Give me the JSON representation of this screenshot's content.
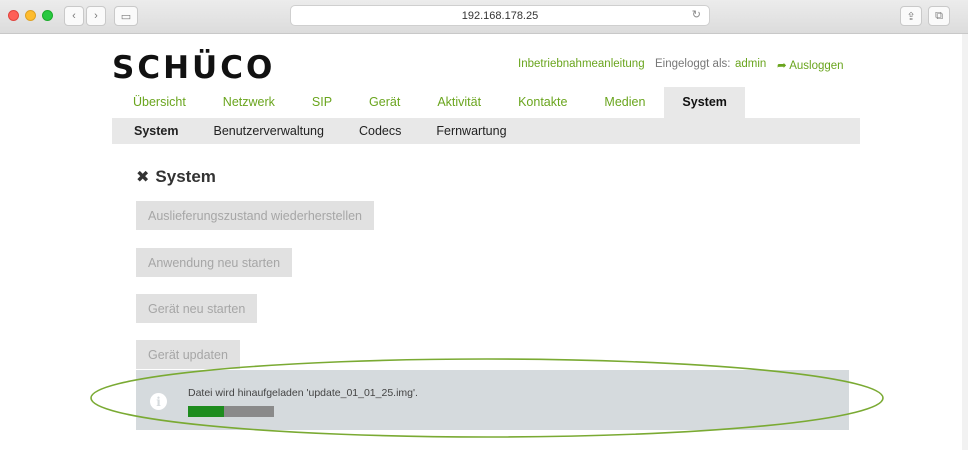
{
  "browser": {
    "address": "192.168.178.25",
    "back_glyph": "‹",
    "forward_glyph": "›",
    "reload_glyph": "↻",
    "share_glyph": "⇪",
    "tabs_glyph": "⧉",
    "sidebar_glyph": "▭"
  },
  "header": {
    "logo": "SCHÜCO",
    "links": {
      "manual": "Inbetriebnahmeanleitung",
      "logged_in_prefix": "Eingeloggt als:",
      "user": "admin",
      "logout": "Ausloggen",
      "logout_icon": "➦"
    }
  },
  "nav": {
    "items": [
      "Übersicht",
      "Netzwerk",
      "SIP",
      "Gerät",
      "Aktivität",
      "Kontakte",
      "Medien",
      "System"
    ],
    "active": "System"
  },
  "subnav": {
    "items": [
      "System",
      "Benutzerverwaltung",
      "Codecs",
      "Fernwartung"
    ],
    "active": "System"
  },
  "page": {
    "title": "System",
    "title_icon": "✖",
    "buttons": {
      "factory_reset": "Auslieferungszustand wiederherstellen",
      "restart_app": "Anwendung neu starten",
      "restart_device": "Gerät neu starten",
      "update_device": "Gerät updaten"
    }
  },
  "notification": {
    "icon": "i",
    "message": "Datei wird hinaufgeladen 'update_01_01_25.img'.",
    "progress_fraction": 0.42
  },
  "colors": {
    "accent_green": "#6aa51e",
    "progress_green": "#1e8c1e",
    "annotation_ellipse": "#7aaa33"
  }
}
